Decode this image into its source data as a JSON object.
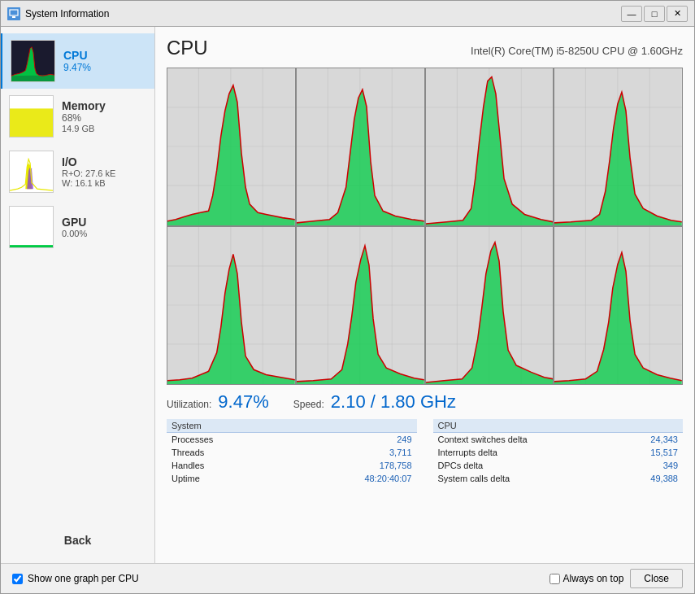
{
  "window": {
    "title": "System Information",
    "controls": {
      "minimize": "—",
      "maximize": "□",
      "close": "✕"
    }
  },
  "sidebar": {
    "items": [
      {
        "id": "cpu",
        "name": "CPU",
        "value": "9.47%",
        "value2": "",
        "active": true
      },
      {
        "id": "memory",
        "name": "Memory",
        "value": "68%",
        "value2": "14.9 GB",
        "active": false
      },
      {
        "id": "io",
        "name": "I/O",
        "value": "R+O: 27.6 kE",
        "value2": "W: 16.1 kB",
        "active": false
      },
      {
        "id": "gpu",
        "name": "GPU",
        "value": "0.00%",
        "value2": "",
        "active": false
      }
    ],
    "back_label": "Back"
  },
  "main": {
    "title": "CPU",
    "cpu_model": "Intel(R) Core(TM) i5-8250U CPU @ 1.60GHz",
    "utilization_label": "Utilization:",
    "utilization_value": "9.47%",
    "speed_label": "Speed:",
    "speed_value": "2.10 / 1.80 GHz",
    "system_table": {
      "header": "System",
      "rows": [
        {
          "label": "Processes",
          "value": "249"
        },
        {
          "label": "Threads",
          "value": "3,711"
        },
        {
          "label": "Handles",
          "value": "178,758"
        },
        {
          "label": "Uptime",
          "value": "48:20:40:07"
        }
      ]
    },
    "cpu_table": {
      "header": "CPU",
      "rows": [
        {
          "label": "Context switches delta",
          "value": "24,343"
        },
        {
          "label": "Interrupts delta",
          "value": "15,517"
        },
        {
          "label": "DPCs delta",
          "value": "349"
        },
        {
          "label": "System calls delta",
          "value": "49,388"
        }
      ]
    }
  },
  "footer": {
    "checkbox_label": "Show one graph per CPU",
    "checkbox_checked": true,
    "always_on_top_label": "Always on top",
    "close_label": "Close"
  }
}
